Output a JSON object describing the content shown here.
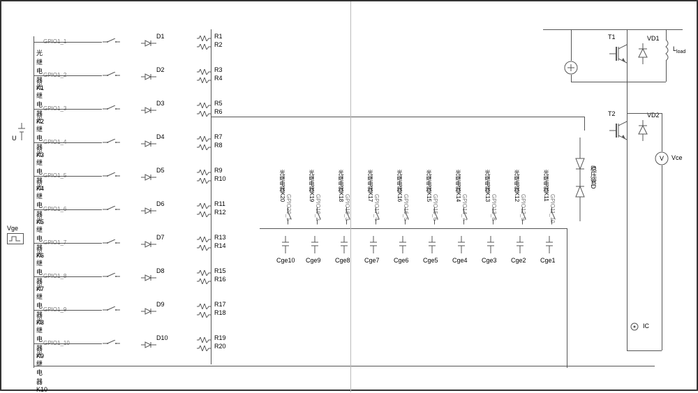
{
  "relay_prefix": "光继电器",
  "zener_label": "稳压管D",
  "left": {
    "U": "U",
    "Vge": "Vge"
  },
  "relays": [
    {
      "gpio": "GPIO1_1",
      "k": "K1",
      "d": "D1",
      "r1": "R1",
      "r2": "R2"
    },
    {
      "gpio": "GPIO1_2",
      "k": "K2",
      "d": "D2",
      "r1": "R3",
      "r2": "R4"
    },
    {
      "gpio": "GPIO1_3",
      "k": "K3",
      "d": "D3",
      "r1": "R5",
      "r2": "R6"
    },
    {
      "gpio": "GPIO1_4",
      "k": "K4",
      "d": "D4",
      "r1": "R7",
      "r2": "R8"
    },
    {
      "gpio": "GPIO1_5",
      "k": "K5",
      "d": "D5",
      "r1": "R9",
      "r2": "R10"
    },
    {
      "gpio": "GPIO1_6",
      "k": "K6",
      "d": "D6",
      "r1": "R11",
      "r2": "R12"
    },
    {
      "gpio": "GPIO1_7",
      "k": "K7",
      "d": "D7",
      "r1": "R13",
      "r2": "R14"
    },
    {
      "gpio": "GPIO1_8",
      "k": "K8",
      "d": "D8",
      "r1": "R15",
      "r2": "R16"
    },
    {
      "gpio": "GPIO1_9",
      "k": "K9",
      "d": "D9",
      "r1": "R17",
      "r2": "R18"
    },
    {
      "gpio": "GPIO1_10",
      "k": "K10",
      "d": "D10",
      "r1": "R19",
      "r2": "R20"
    }
  ],
  "caps": [
    {
      "gpio": "GPIO11_10",
      "relay": "光继电器K11",
      "c": "Cge1"
    },
    {
      "gpio": "GPIO12_9",
      "relay": "光继电器K12",
      "c": "Cge2"
    },
    {
      "gpio": "GPIO13_8",
      "relay": "光继电器K13",
      "c": "Cge3"
    },
    {
      "gpio": "GPIO14_7",
      "relay": "光继电器K14",
      "c": "Cge4"
    },
    {
      "gpio": "GPIO15_6",
      "relay": "光继电器K15",
      "c": "Cge5"
    },
    {
      "gpio": "GPIO16_5",
      "relay": "光继电器K16",
      "c": "Cge6"
    },
    {
      "gpio": "GPIO17_4",
      "relay": "光继电器K17",
      "c": "Cge7"
    },
    {
      "gpio": "GPIO18_3",
      "relay": "光继电器K18",
      "c": "Cge8"
    },
    {
      "gpio": "GPIO19_2",
      "relay": "光继电器K19",
      "c": "Cge9"
    },
    {
      "gpio": "GPIO20_1",
      "relay": "光继电器K20",
      "c": "Cge10"
    }
  ],
  "right": {
    "T1": "T1",
    "VD1": "VD1",
    "T2": "T2",
    "VD2": "VD2",
    "Lload": "L",
    "Lload_sub": "load",
    "Vce": "Vce",
    "IC": "IC"
  }
}
